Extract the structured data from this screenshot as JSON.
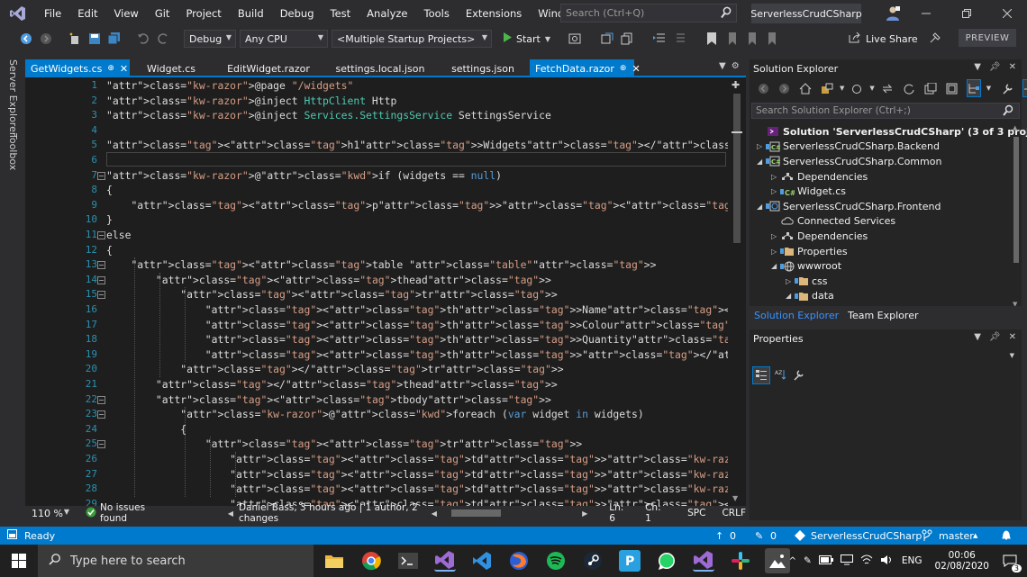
{
  "menu": [
    "File",
    "Edit",
    "View",
    "Git",
    "Project",
    "Build",
    "Debug",
    "Test",
    "Analyze",
    "Tools",
    "Extensions",
    "Window",
    "Help"
  ],
  "search": {
    "placeholder": "Search (Ctrl+Q)"
  },
  "solution_name": "ServerlessCrudCSharp",
  "toolbar": {
    "config": "Debug",
    "platform": "Any CPU",
    "startup": "<Multiple Startup Projects>",
    "start_label": "Start",
    "live_share": "Live Share",
    "preview": "PREVIEW"
  },
  "side_tabs": [
    "Server Explorer",
    "Toolbox"
  ],
  "doc_tabs": [
    {
      "label": "GetWidgets.cs",
      "state": "preview"
    },
    {
      "label": "Widget.cs",
      "state": "normal"
    },
    {
      "label": "EditWidget.razor",
      "state": "normal"
    },
    {
      "label": "settings.local.json",
      "state": "normal"
    },
    {
      "label": "settings.json",
      "state": "normal"
    },
    {
      "label": "FetchData.razor",
      "state": "active"
    }
  ],
  "code_lines": [
    "@page \"/widgets\"",
    "@inject HttpClient Http",
    "@inject Services.SettingsService SettingsService",
    "",
    "<h1>Widgets</h1>",
    "",
    "@if (widgets == null)",
    "{",
    "    <p><em>Loading...</em></p>",
    "}",
    "else",
    "{",
    "    <table class=\"table\">",
    "        <thead>",
    "            <tr>",
    "                <th>Name</th>",
    "                <th>Colour</th>",
    "                <th>Quantity</th>",
    "                <th></th>",
    "            </tr>",
    "        </thead>",
    "        <tbody>",
    "            @foreach (var widget in widgets)",
    "            {",
    "                <tr>",
    "                    <td>@widget.Name</td>",
    "                    <td>@widget.Colour</td>",
    "                    <td>@widget.Quantity</td>",
    "                    <td><a class=\"btn btn-info\" href=\"/widgets/@widget.Id\">Edit</a><button style=\""
  ],
  "editor_status": {
    "zoom": "110 %",
    "issues": "No issues found",
    "blame": "Daniel Bass, 3 hours ago | 1 author, 2 changes",
    "ln": "Ln: 6",
    "ch": "Ch: 1",
    "spc": "SPC",
    "crlf": "CRLF"
  },
  "solution_explorer": {
    "title": "Solution Explorer",
    "search_placeholder": "Search Solution Explorer (Ctrl+;)",
    "tree": [
      {
        "label": "Solution 'ServerlessCrudCSharp' (3 of 3 projects)",
        "depth": 0,
        "icon": "solution-icon",
        "expander": "",
        "bold": true
      },
      {
        "label": "ServerlessCrudCSharp.Backend",
        "depth": 0,
        "icon": "csharp-project-icon",
        "expander": "collapsed",
        "bold": false
      },
      {
        "label": "ServerlessCrudCSharp.Common",
        "depth": 0,
        "icon": "csharp-project-icon",
        "expander": "expanded",
        "bold": false
      },
      {
        "label": "Dependencies",
        "depth": 1,
        "icon": "dependencies-icon",
        "expander": "collapsed",
        "bold": false
      },
      {
        "label": "Widget.cs",
        "depth": 1,
        "icon": "csharp-file-icon",
        "expander": "collapsed",
        "bold": false
      },
      {
        "label": "ServerlessCrudCSharp.Frontend",
        "depth": 0,
        "icon": "web-project-icon",
        "expander": "expanded",
        "bold": false
      },
      {
        "label": "Connected Services",
        "depth": 1,
        "icon": "connected-services-icon",
        "expander": "",
        "bold": false
      },
      {
        "label": "Dependencies",
        "depth": 1,
        "icon": "dependencies-icon",
        "expander": "collapsed",
        "bold": false
      },
      {
        "label": "Properties",
        "depth": 1,
        "icon": "properties-folder-icon",
        "expander": "collapsed",
        "bold": false
      },
      {
        "label": "wwwroot",
        "depth": 1,
        "icon": "globe-icon",
        "expander": "expanded",
        "bold": false
      },
      {
        "label": "css",
        "depth": 2,
        "icon": "folder-icon",
        "expander": "collapsed",
        "bold": false
      },
      {
        "label": "data",
        "depth": 2,
        "icon": "folder-icon",
        "expander": "expanded",
        "bold": false
      }
    ],
    "bottom_tabs": [
      "Solution Explorer",
      "Team Explorer"
    ]
  },
  "properties": {
    "title": "Properties"
  },
  "statusbar": {
    "ready": "Ready",
    "up_count": "0",
    "edit_count": "0",
    "solution": "ServerlessCrudCSharp",
    "branch": "master",
    "notifications": "3"
  },
  "taskbar": {
    "search_placeholder": "Type here to search",
    "lang": "ENG",
    "time": "00:06",
    "date": "02/08/2020",
    "notif_count": "3"
  },
  "colors": {
    "accent": "#007acc",
    "bg": "#1e1e1e",
    "chrome": "#2d2d30"
  }
}
